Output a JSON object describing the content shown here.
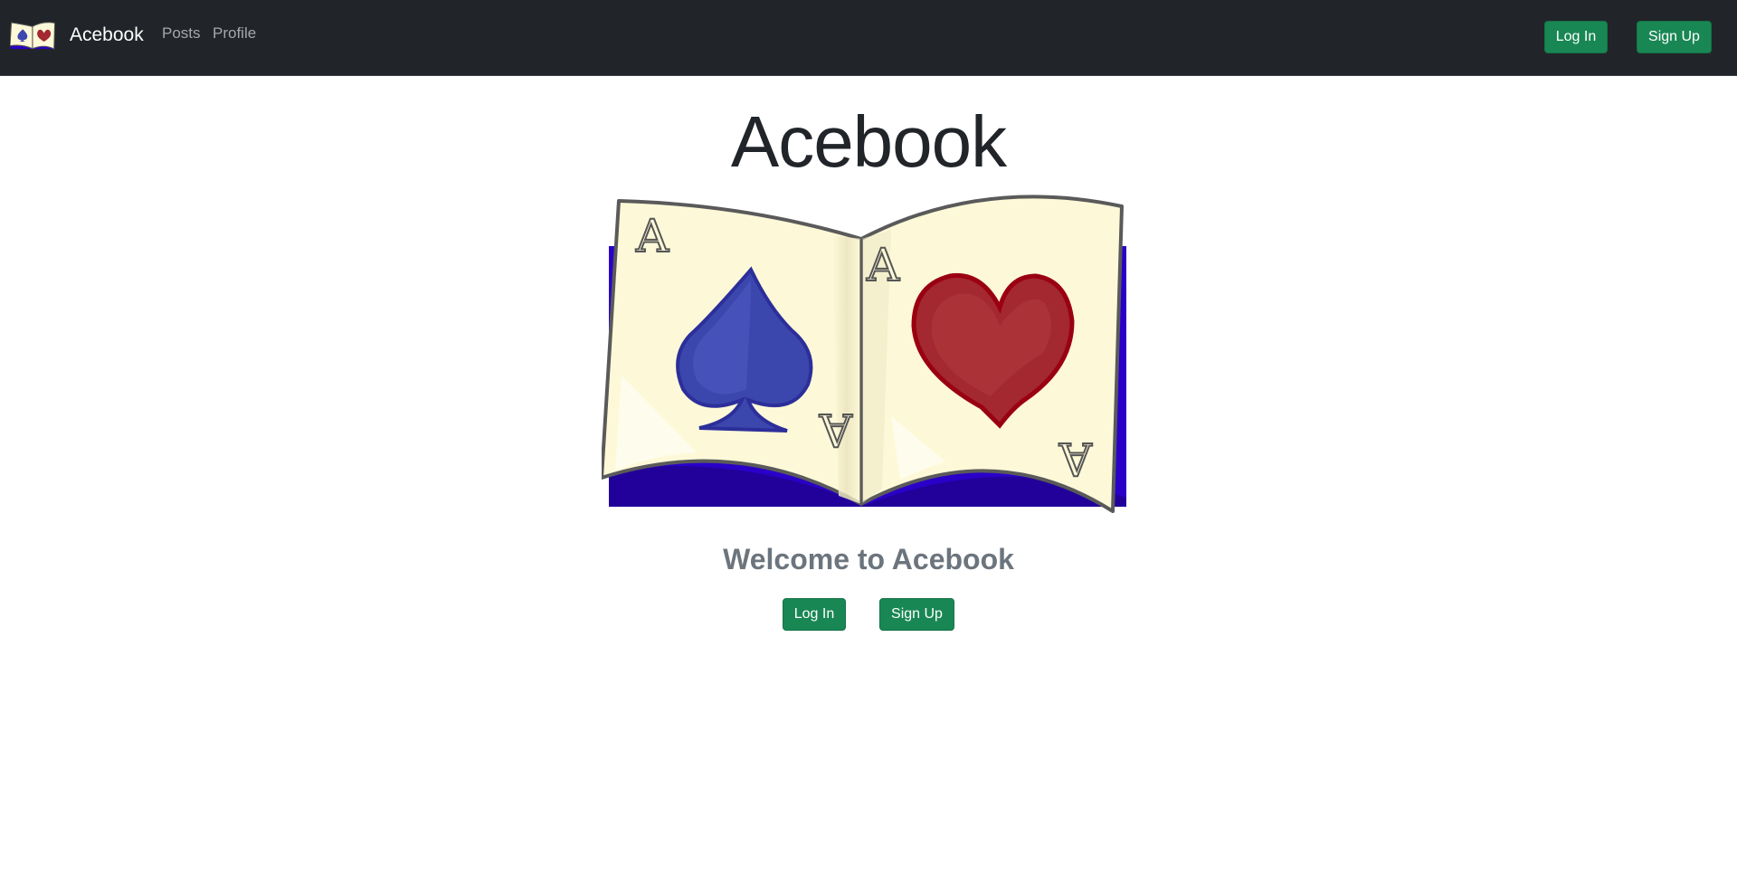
{
  "navbar": {
    "brand": "Acebook",
    "links": [
      {
        "label": "Posts"
      },
      {
        "label": "Profile"
      }
    ],
    "login_label": "Log In",
    "signup_label": "Sign Up"
  },
  "hero": {
    "title": "Acebook",
    "welcome": "Welcome to Acebook",
    "login_label": "Log In",
    "signup_label": "Sign Up"
  },
  "icons": {
    "brand_logo": "ace-book-logo-icon",
    "hero_image": "ace-book-illustration"
  },
  "colors": {
    "navbar_bg": "#212529",
    "button_green": "#198754",
    "muted_text": "#6c757d",
    "spade_blue": "#3d47b0",
    "heart_red": "#a3282f",
    "book_cover": "#2a00c8"
  }
}
